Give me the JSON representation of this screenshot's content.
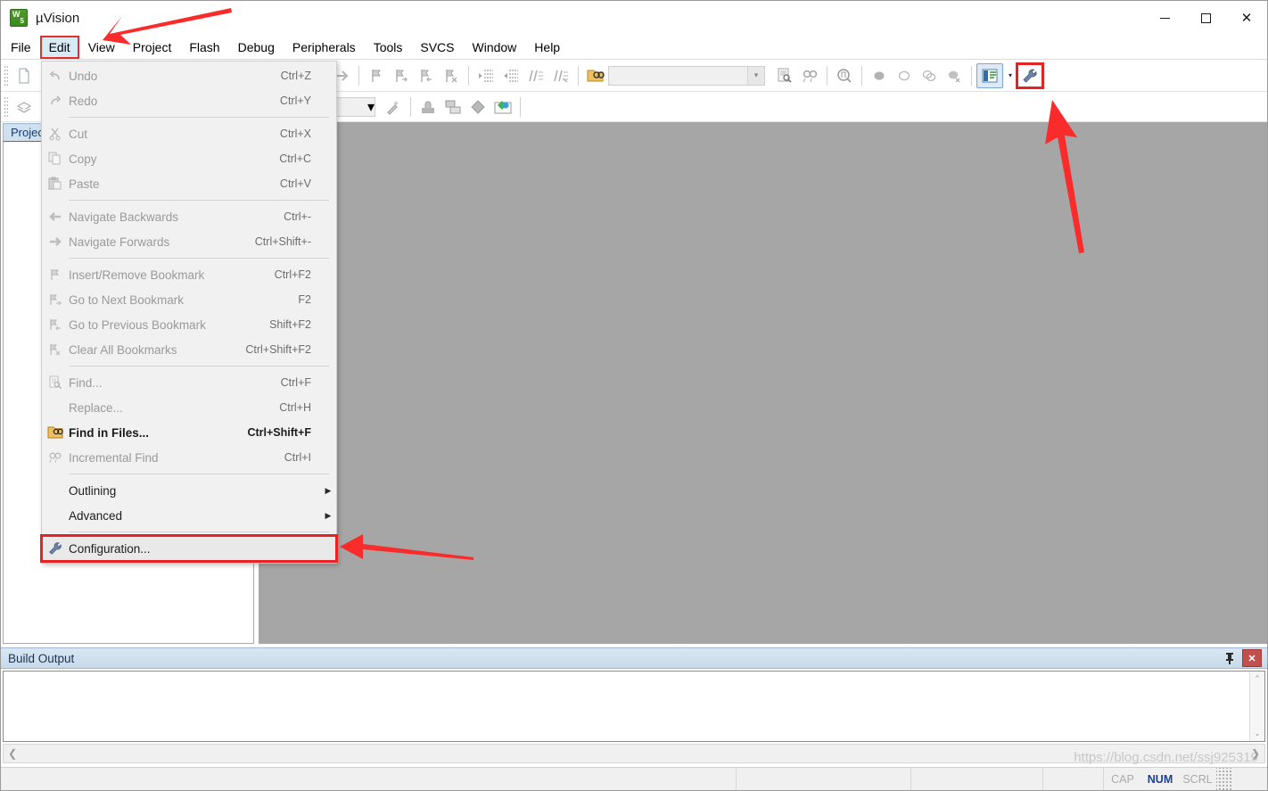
{
  "window": {
    "title": "µVision",
    "logo_icon": "uvision-logo-icon",
    "minimize_label": "Minimize",
    "maximize_label": "Maximize",
    "close_label": "Close"
  },
  "menubar": {
    "items": [
      {
        "label": "File",
        "open": false
      },
      {
        "label": "Edit",
        "open": true
      },
      {
        "label": "View",
        "open": false
      },
      {
        "label": "Project",
        "open": false
      },
      {
        "label": "Flash",
        "open": false
      },
      {
        "label": "Debug",
        "open": false
      },
      {
        "label": "Peripherals",
        "open": false
      },
      {
        "label": "Tools",
        "open": false
      },
      {
        "label": "SVCS",
        "open": false
      },
      {
        "label": "Window",
        "open": false
      },
      {
        "label": "Help",
        "open": false
      }
    ]
  },
  "edit_menu": {
    "groups": [
      {
        "items": [
          {
            "label": "Undo",
            "shortcut": "Ctrl+Z",
            "icon": "undo-icon",
            "state": "disabled"
          },
          {
            "label": "Redo",
            "shortcut": "Ctrl+Y",
            "icon": "redo-icon",
            "state": "disabled"
          }
        ]
      },
      {
        "items": [
          {
            "label": "Cut",
            "shortcut": "Ctrl+X",
            "icon": "cut-icon",
            "state": "disabled"
          },
          {
            "label": "Copy",
            "shortcut": "Ctrl+C",
            "icon": "copy-icon",
            "state": "disabled"
          },
          {
            "label": "Paste",
            "shortcut": "Ctrl+V",
            "icon": "paste-icon",
            "state": "disabled"
          }
        ]
      },
      {
        "items": [
          {
            "label": "Navigate Backwards",
            "shortcut": "Ctrl+-",
            "icon": "arrow-left-icon",
            "state": "disabled"
          },
          {
            "label": "Navigate Forwards",
            "shortcut": "Ctrl+Shift+-",
            "icon": "arrow-right-icon",
            "state": "disabled"
          }
        ]
      },
      {
        "items": [
          {
            "label": "Insert/Remove Bookmark",
            "shortcut": "Ctrl+F2",
            "icon": "bookmark-icon",
            "state": "disabled"
          },
          {
            "label": "Go to Next Bookmark",
            "shortcut": "F2",
            "icon": "bookmark-next-icon",
            "state": "disabled"
          },
          {
            "label": "Go to Previous Bookmark",
            "shortcut": "Shift+F2",
            "icon": "bookmark-prev-icon",
            "state": "disabled"
          },
          {
            "label": "Clear All Bookmarks",
            "shortcut": "Ctrl+Shift+F2",
            "icon": "bookmark-clear-icon",
            "state": "disabled"
          }
        ]
      },
      {
        "items": [
          {
            "label": "Find...",
            "shortcut": "Ctrl+F",
            "icon": "find-icon",
            "state": "disabled"
          },
          {
            "label": "Replace...",
            "shortcut": "Ctrl+H",
            "icon": "replace-icon",
            "state": "disabled"
          },
          {
            "label": "Find in Files...",
            "shortcut": "Ctrl+Shift+F",
            "icon": "find-in-files-icon",
            "state": "enabled"
          },
          {
            "label": "Incremental Find",
            "shortcut": "Ctrl+I",
            "icon": "incremental-find-icon",
            "state": "disabled"
          }
        ]
      },
      {
        "items": [
          {
            "label": "Outlining",
            "shortcut": "",
            "icon": "",
            "state": "plain",
            "submenu": true
          },
          {
            "label": "Advanced",
            "shortcut": "",
            "icon": "",
            "state": "plain",
            "submenu": true
          }
        ]
      },
      {
        "items": [
          {
            "label": "Configuration...",
            "shortcut": "",
            "icon": "wrench-icon",
            "state": "plain",
            "highlighted": true
          }
        ]
      }
    ]
  },
  "toolbar_row1": {
    "items": [
      {
        "icon": "new-file-icon",
        "name": "new-file-button"
      },
      {
        "icon": "open-file-icon",
        "name": "open-file-button"
      },
      {
        "icon": "save-icon",
        "name": "save-button"
      },
      {
        "icon": "save-all-icon",
        "name": "save-all-button"
      },
      {
        "icon": "cut-icon",
        "name": "cut-button"
      },
      {
        "icon": "copy-icon",
        "name": "copy-button"
      },
      {
        "icon": "paste-icon",
        "name": "paste-button"
      },
      {
        "icon": "undo-icon",
        "name": "undo-button"
      },
      {
        "icon": "redo-icon",
        "name": "redo-button"
      },
      {
        "icon": "nav-back-icon",
        "name": "navigate-backwards-button"
      },
      {
        "icon": "nav-forward-icon",
        "name": "navigate-forwards-button"
      },
      {
        "icon": "bookmark-icon",
        "name": "insert-bookmark-button"
      },
      {
        "icon": "bookmark-next-icon",
        "name": "next-bookmark-button"
      },
      {
        "icon": "bookmark-prev-icon",
        "name": "prev-bookmark-button"
      },
      {
        "icon": "bookmark-clear-icon",
        "name": "clear-bookmarks-button"
      },
      {
        "icon": "indent-icon",
        "name": "indent-button"
      },
      {
        "icon": "outdent-icon",
        "name": "outdent-button"
      },
      {
        "icon": "comment-icon",
        "name": "comment-button"
      },
      {
        "icon": "uncomment-icon",
        "name": "uncomment-button"
      },
      {
        "icon": "find-in-files-icon",
        "name": "find-in-files-button"
      }
    ],
    "search_box": {
      "value": "",
      "placeholder": ""
    },
    "after_search": [
      {
        "icon": "find-icon",
        "name": "find-button"
      },
      {
        "icon": "incremental-find-icon",
        "name": "incremental-find-button"
      },
      {
        "icon": "magnifier-icon",
        "name": "browse-symbol-button"
      },
      {
        "icon": "breakpoint-filled-icon",
        "name": "insert-breakpoint-button"
      },
      {
        "icon": "breakpoint-empty-icon",
        "name": "disable-breakpoint-button"
      },
      {
        "icon": "breakpoint-pair-icon",
        "name": "kill-all-breakpoints-button"
      },
      {
        "icon": "breakpoint-disable-all-icon",
        "name": "disable-all-breakpoints-button"
      },
      {
        "icon": "project-window-icon",
        "name": "project-window-toggle",
        "active": true
      },
      {
        "icon": "chevron-down-icon",
        "name": "project-window-dropdown"
      },
      {
        "icon": "wrench-icon",
        "name": "configuration-button",
        "highlighted": true
      }
    ]
  },
  "toolbar_row2": {
    "items_before": [
      {
        "icon": "project-stack-icon",
        "name": "target-select-icon"
      }
    ],
    "target_combo": {
      "value": "",
      "placeholder": ""
    },
    "items_after": [
      {
        "icon": "magic-wand-icon",
        "name": "options-for-target-button"
      },
      {
        "icon": "manage-project-icon",
        "name": "manage-project-items-button"
      },
      {
        "icon": "multi-project-icon",
        "name": "multi-project-button"
      },
      {
        "icon": "diamond-icon",
        "name": "batch-build-button"
      },
      {
        "icon": "pack-installer-icon",
        "name": "pack-installer-button"
      }
    ]
  },
  "project_panel": {
    "tab_label": "Project"
  },
  "build_output": {
    "title": "Build Output",
    "pin_icon": "pin-icon",
    "close_icon": "close-icon",
    "content": ""
  },
  "statusbar": {
    "message": "",
    "indicators": [
      {
        "label": "CAP",
        "on": false
      },
      {
        "label": "NUM",
        "on": true
      },
      {
        "label": "SCRL",
        "on": false
      }
    ]
  },
  "watermark": {
    "text": "https://blog.csdn.net/ssj925319"
  },
  "annotations": {
    "accent_color": "#fa2b2b",
    "highlight_color": "#e62222",
    "arrows": [
      {
        "name": "arrow-to-edit-menu",
        "target": "Edit menu"
      },
      {
        "name": "arrow-to-configuration-item",
        "target": "Configuration... menu item"
      },
      {
        "name": "arrow-to-configuration-toolbar-button",
        "target": "Configuration toolbar button"
      }
    ]
  }
}
